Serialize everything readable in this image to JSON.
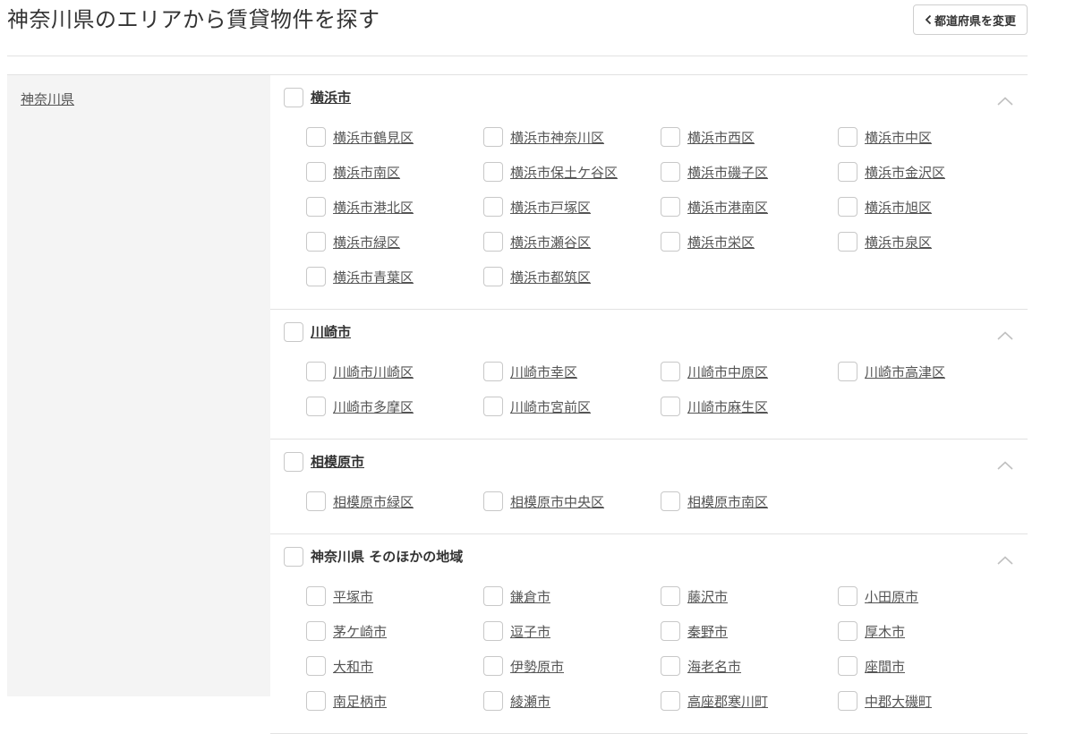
{
  "page": {
    "title": "神奈川県のエリアから賃貸物件を探す"
  },
  "header": {
    "change_button_label": "都道府県を変更"
  },
  "sidebar": {
    "prefecture_label": "神奈川県"
  },
  "sections": [
    {
      "title": "横浜市",
      "title_underlined": true,
      "expanded": true,
      "items": [
        "横浜市鶴見区",
        "横浜市神奈川区",
        "横浜市西区",
        "横浜市中区",
        "横浜市南区",
        "横浜市保土ケ谷区",
        "横浜市磯子区",
        "横浜市金沢区",
        "横浜市港北区",
        "横浜市戸塚区",
        "横浜市港南区",
        "横浜市旭区",
        "横浜市緑区",
        "横浜市瀬谷区",
        "横浜市栄区",
        "横浜市泉区",
        "横浜市青葉区",
        "横浜市都筑区"
      ]
    },
    {
      "title": "川崎市",
      "title_underlined": true,
      "expanded": true,
      "items": [
        "川崎市川崎区",
        "川崎市幸区",
        "川崎市中原区",
        "川崎市高津区",
        "川崎市多摩区",
        "川崎市宮前区",
        "川崎市麻生区"
      ]
    },
    {
      "title": "相模原市",
      "title_underlined": true,
      "expanded": true,
      "items": [
        "相模原市緑区",
        "相模原市中央区",
        "相模原市南区"
      ]
    },
    {
      "title": "神奈川県 そのほかの地域",
      "title_underlined": false,
      "expanded": true,
      "items": [
        "平塚市",
        "鎌倉市",
        "藤沢市",
        "小田原市",
        "茅ケ崎市",
        "逗子市",
        "秦野市",
        "厚木市",
        "大和市",
        "伊勢原市",
        "海老名市",
        "座間市",
        "南足柄市",
        "綾瀬市",
        "高座郡寒川町",
        "中郡大磯町"
      ]
    }
  ],
  "colors": {
    "sidebar_bg": "#f4f4f4",
    "divider": "#e2e2e2",
    "checkbox_border": "#c8c8c8",
    "text": "#333333",
    "link": "#555555"
  }
}
